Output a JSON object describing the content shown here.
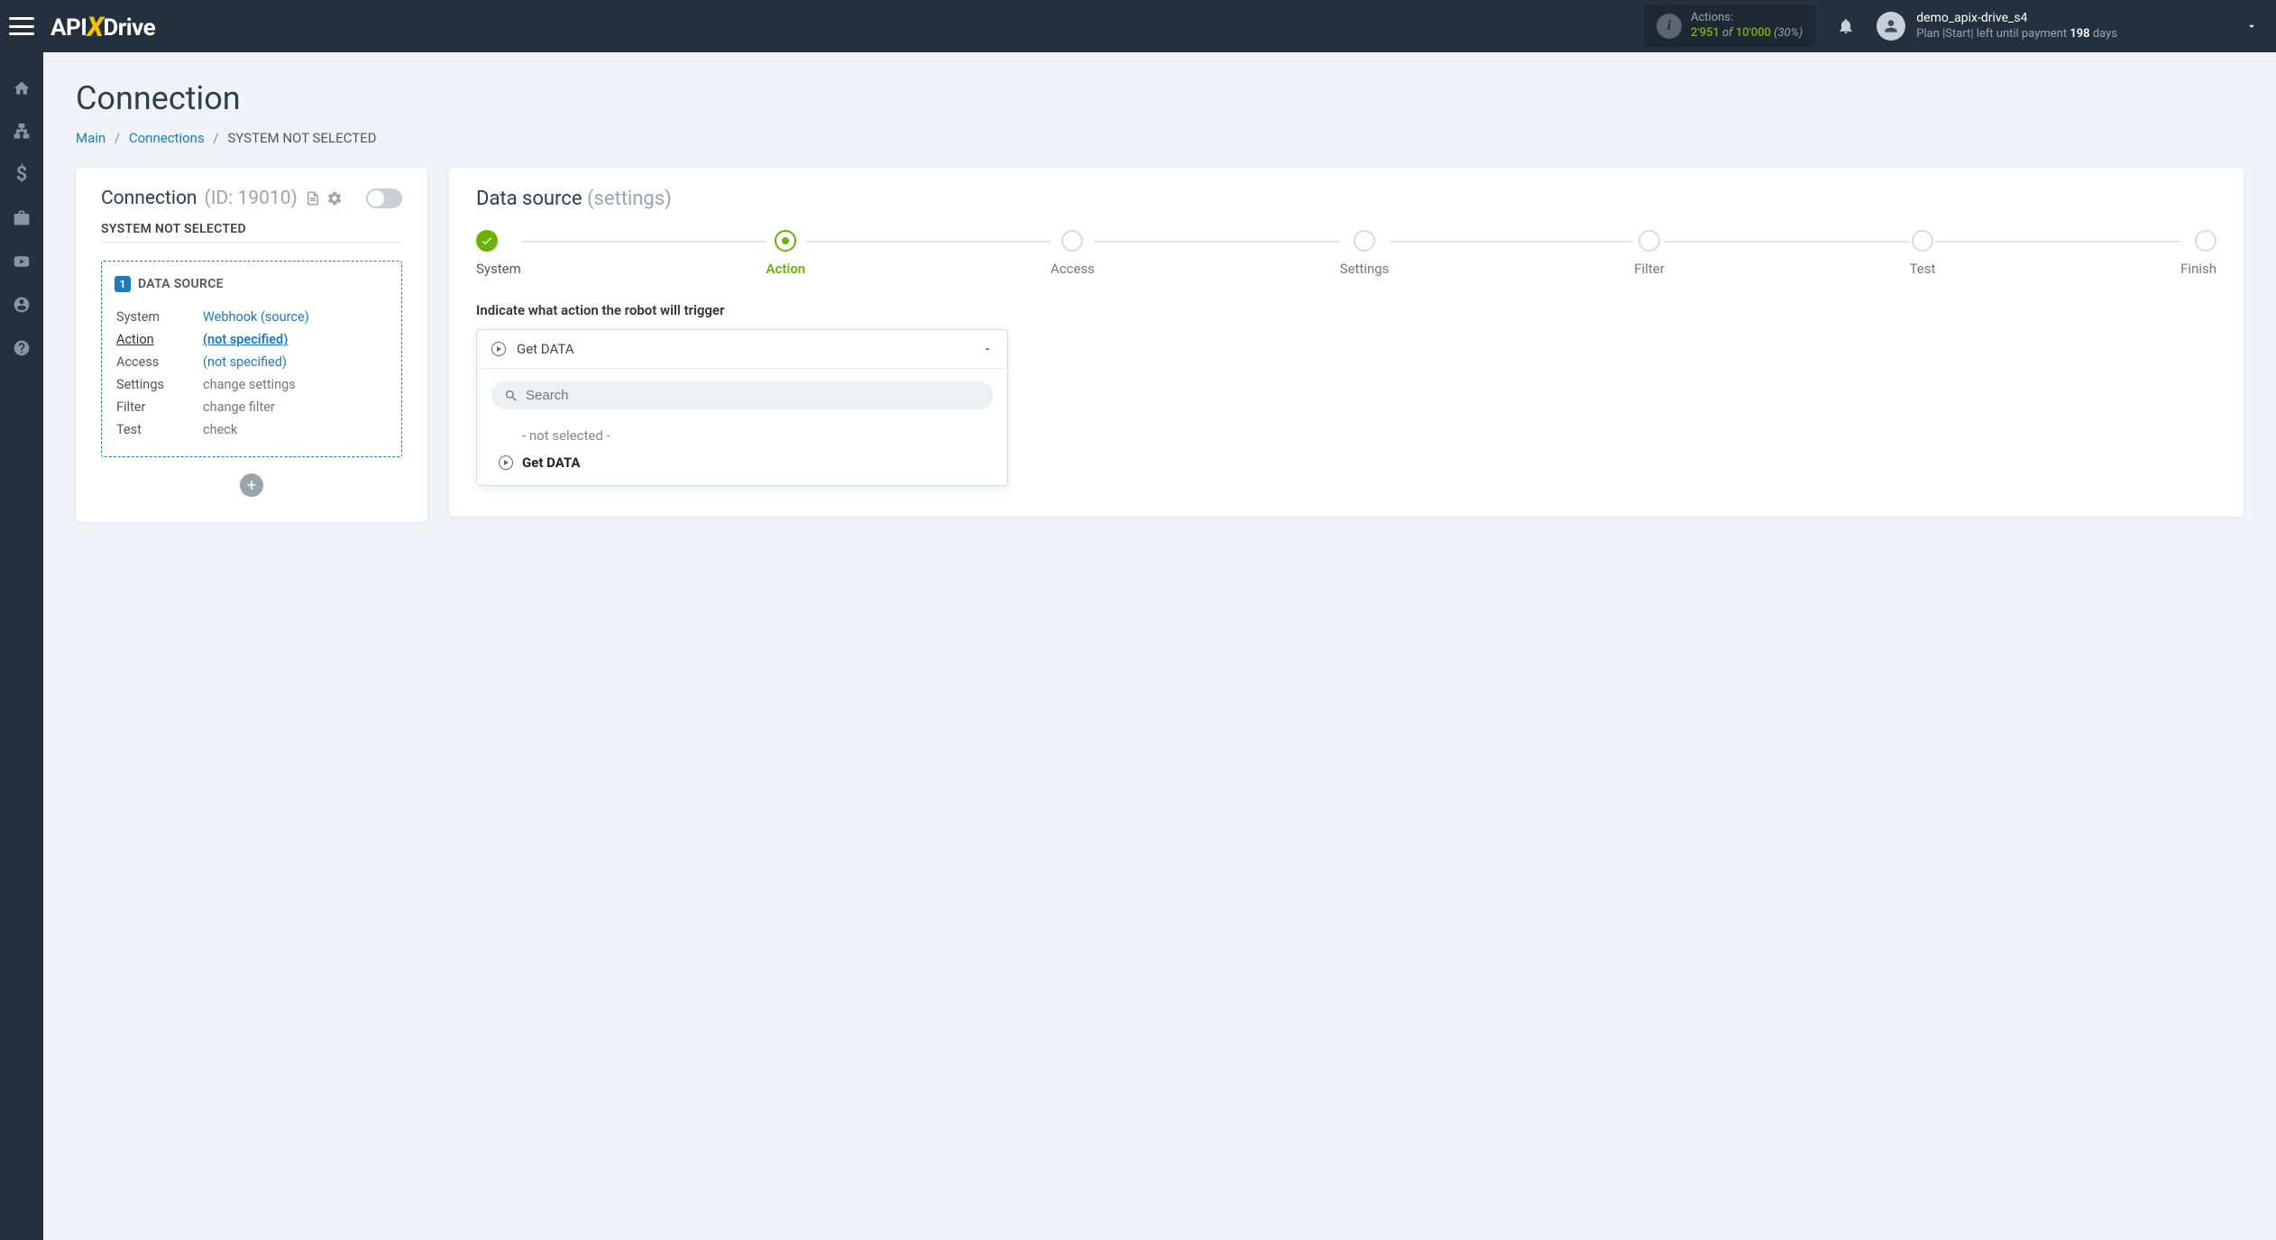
{
  "header": {
    "actions_label": "Actions:",
    "actions_used": "2'951",
    "actions_of": "of",
    "actions_total": "10'000",
    "actions_pct": "(30%)",
    "user_name": "demo_apix-drive_s4",
    "plan_prefix": "Plan ",
    "plan_name": "|Start|",
    "plan_until": " left until payment ",
    "plan_days": "198",
    "plan_suffix": " days"
  },
  "page": {
    "title": "Connection",
    "crumb_main": "Main",
    "crumb_conn": "Connections",
    "crumb_cur": "SYSTEM NOT SELECTED"
  },
  "left": {
    "title": "Connection",
    "id_label": "(ID: 19010)",
    "subtitle": "SYSTEM NOT SELECTED",
    "ds_num": "1",
    "ds_label": "DATA SOURCE",
    "rows": {
      "system_k": "System",
      "system_v": "Webhook (source)",
      "action_k": "Action",
      "action_v": "(not specified)",
      "access_k": "Access",
      "access_v": "(not specified)",
      "settings_k": "Settings",
      "settings_v": "change settings",
      "filter_k": "Filter",
      "filter_v": "change filter",
      "test_k": "Test",
      "test_v": "check"
    }
  },
  "right": {
    "title": "Data source",
    "title_sub": "(settings)",
    "steps": [
      "System",
      "Action",
      "Access",
      "Settings",
      "Filter",
      "Test",
      "Finish"
    ],
    "label": "Indicate what action the robot will trigger",
    "dd_value": "Get DATA",
    "search_placeholder": "Search",
    "opt_not_selected": "- not selected -",
    "opt_get": "Get DATA"
  }
}
